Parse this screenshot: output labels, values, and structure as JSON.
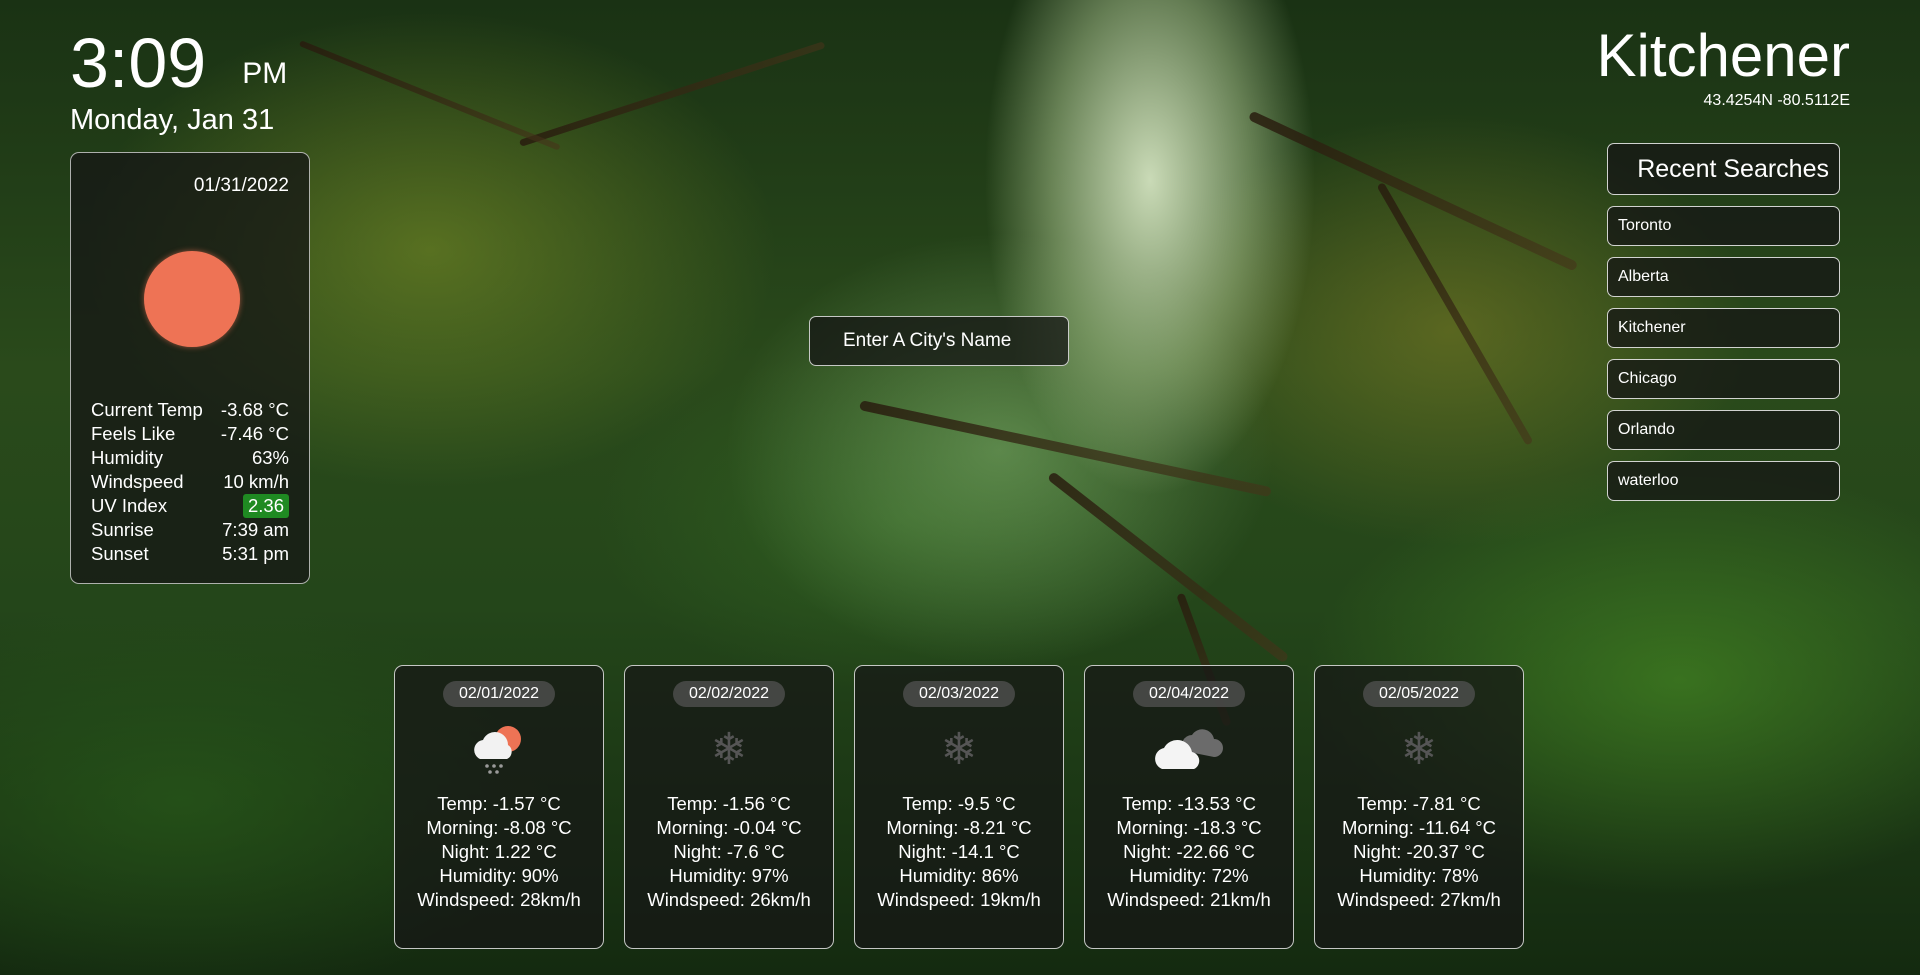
{
  "clock": {
    "time": "3:09",
    "ampm": "PM",
    "date": "Monday, Jan 31"
  },
  "today": {
    "date": "01/31/2022",
    "icon": "sun-icon",
    "stats": [
      {
        "label": "Current Temp",
        "value": "-3.68 °C"
      },
      {
        "label": "Feels Like",
        "value": "-7.46 °C"
      },
      {
        "label": "Humidity",
        "value": "63%"
      },
      {
        "label": "Windspeed",
        "value": "10 km/h"
      },
      {
        "label": "UV Index",
        "value": "2.36"
      },
      {
        "label": "Sunrise",
        "value": "7:39 am"
      },
      {
        "label": "Sunset",
        "value": "5:31 pm"
      }
    ],
    "uv_color": "#1f8a22"
  },
  "location": {
    "city": "Kitchener",
    "coords": "43.4254N -80.5112E"
  },
  "search": {
    "placeholder": "Enter A City's Name"
  },
  "recent": {
    "title": "Recent Searches",
    "items": [
      "Toronto",
      "Alberta",
      "Kitchener",
      "Chicago",
      "Orlando",
      "waterloo"
    ]
  },
  "forecast": [
    {
      "date": "02/01/2022",
      "icon": "rain-cloud-sun-icon",
      "temp": "Temp: -1.57 °C",
      "morning": "Morning: -8.08 °C",
      "night": "Night: 1.22 °C",
      "humidity": "Humidity: 90%",
      "wind": "Windspeed: 28km/h"
    },
    {
      "date": "02/02/2022",
      "icon": "snowflake-icon",
      "temp": "Temp: -1.56 °C",
      "morning": "Morning: -0.04 °C",
      "night": "Night: -7.6 °C",
      "humidity": "Humidity: 97%",
      "wind": "Windspeed: 26km/h"
    },
    {
      "date": "02/03/2022",
      "icon": "snowflake-icon",
      "temp": "Temp: -9.5 °C",
      "morning": "Morning: -8.21 °C",
      "night": "Night: -14.1 °C",
      "humidity": "Humidity: 86%",
      "wind": "Windspeed: 19km/h"
    },
    {
      "date": "02/04/2022",
      "icon": "cloud-icon",
      "temp": "Temp: -13.53 °C",
      "morning": "Morning: -18.3 °C",
      "night": "Night: -22.66 °C",
      "humidity": "Humidity: 72%",
      "wind": "Windspeed: 21km/h"
    },
    {
      "date": "02/05/2022",
      "icon": "snowflake-icon",
      "temp": "Temp: -7.81 °C",
      "morning": "Morning: -11.64 °C",
      "night": "Night: -20.37 °C",
      "humidity": "Humidity: 78%",
      "wind": "Windspeed: 27km/h"
    }
  ],
  "colors": {
    "sun": "#ee7355",
    "snowflake": "#555555",
    "card_bg": "rgba(22,22,22,0.75)"
  }
}
